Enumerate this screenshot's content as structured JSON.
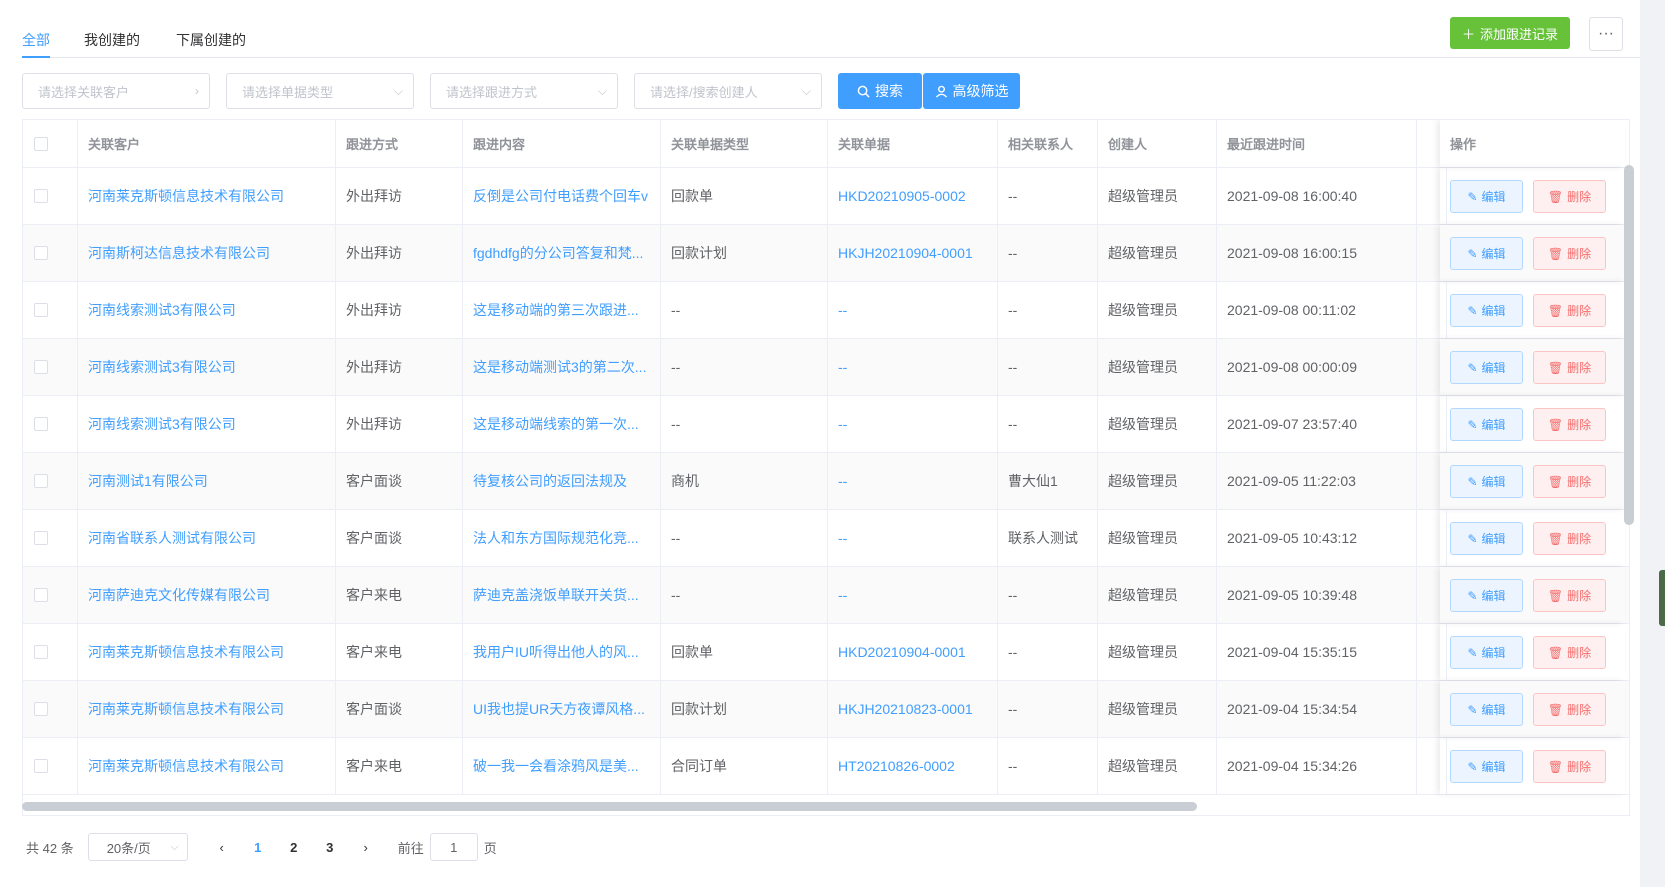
{
  "tabs": [
    "全部",
    "我创建的",
    "下属创建的"
  ],
  "add_button": "添加跟进记录",
  "more_button": "···",
  "filters": {
    "customer": "请选择关联客户",
    "doc_type": "请选择单据类型",
    "method": "请选择跟进方式",
    "creator": "请选择/搜索创建人"
  },
  "search_button": "搜索",
  "advanced_button": "高级筛选",
  "columns": [
    "关联客户",
    "跟进方式",
    "跟进内容",
    "关联单据类型",
    "关联单据",
    "相关联系人",
    "创建人",
    "最近跟进时间",
    "操作"
  ],
  "edit_label": "编辑",
  "delete_label": "删除",
  "rows": [
    {
      "customer": "河南莱克斯顿信息技术有限公司",
      "method": "外出拜访",
      "content": "反倒是公司付电话费个回车v",
      "doc_type": "回款单",
      "doc": "HKD20210905-0002",
      "contact": "--",
      "creator": "超级管理员",
      "time": "2021-09-08 16:00:40"
    },
    {
      "customer": "河南斯柯达信息技术有限公司",
      "method": "外出拜访",
      "content": "fgdhdfg的分公司答复和梵...",
      "doc_type": "回款计划",
      "doc": "HKJH20210904-0001",
      "contact": "--",
      "creator": "超级管理员",
      "time": "2021-09-08 16:00:15"
    },
    {
      "customer": "河南线索测试3有限公司",
      "method": "外出拜访",
      "content": "这是移动端的第三次跟进...",
      "doc_type": "--",
      "doc": "--",
      "contact": "--",
      "creator": "超级管理员",
      "time": "2021-09-08 00:11:02"
    },
    {
      "customer": "河南线索测试3有限公司",
      "method": "外出拜访",
      "content": "这是移动端测试3的第二次...",
      "doc_type": "--",
      "doc": "--",
      "contact": "--",
      "creator": "超级管理员",
      "time": "2021-09-08 00:00:09"
    },
    {
      "customer": "河南线索测试3有限公司",
      "method": "外出拜访",
      "content": "这是移动端线索的第一次...",
      "doc_type": "--",
      "doc": "--",
      "contact": "--",
      "creator": "超级管理员",
      "time": "2021-09-07 23:57:40"
    },
    {
      "customer": "河南测试1有限公司",
      "method": "客户面谈",
      "content": "待复核公司的返回法规及",
      "doc_type": "商机",
      "doc": "--",
      "contact": "曹大仙1",
      "creator": "超级管理员",
      "time": "2021-09-05 11:22:03"
    },
    {
      "customer": "河南省联系人测试有限公司",
      "method": "客户面谈",
      "content": "法人和东方国际规范化竞...",
      "doc_type": "--",
      "doc": "--",
      "contact": "联系人测试",
      "creator": "超级管理员",
      "time": "2021-09-05 10:43:12"
    },
    {
      "customer": "河南萨迪克文化传媒有限公司",
      "method": "客户来电",
      "content": "萨迪克盖浇饭单联开关货...",
      "doc_type": "--",
      "doc": "--",
      "contact": "--",
      "creator": "超级管理员",
      "time": "2021-09-05 10:39:48"
    },
    {
      "customer": "河南莱克斯顿信息技术有限公司",
      "method": "客户来电",
      "content": "我用户IU听得出他人的风...",
      "doc_type": "回款单",
      "doc": "HKD20210904-0001",
      "contact": "--",
      "creator": "超级管理员",
      "time": "2021-09-04 15:35:15"
    },
    {
      "customer": "河南莱克斯顿信息技术有限公司",
      "method": "客户面谈",
      "content": "UI我也提UR天方夜谭风格...",
      "doc_type": "回款计划",
      "doc": "HKJH20210823-0001",
      "contact": "--",
      "creator": "超级管理员",
      "time": "2021-09-04 15:34:54"
    },
    {
      "customer": "河南莱克斯顿信息技术有限公司",
      "method": "客户来电",
      "content": "破一我一会看涂鸦风是美...",
      "doc_type": "合同订单",
      "doc": "HT20210826-0002",
      "contact": "--",
      "creator": "超级管理员",
      "time": "2021-09-04 15:34:26"
    }
  ],
  "pagination": {
    "total": "共 42 条",
    "page_size": "20条/页",
    "pages": [
      "1",
      "2",
      "3"
    ],
    "prev": "‹",
    "next": "›",
    "goto_prefix": "前往",
    "goto_value": "1",
    "goto_suffix": "页"
  }
}
